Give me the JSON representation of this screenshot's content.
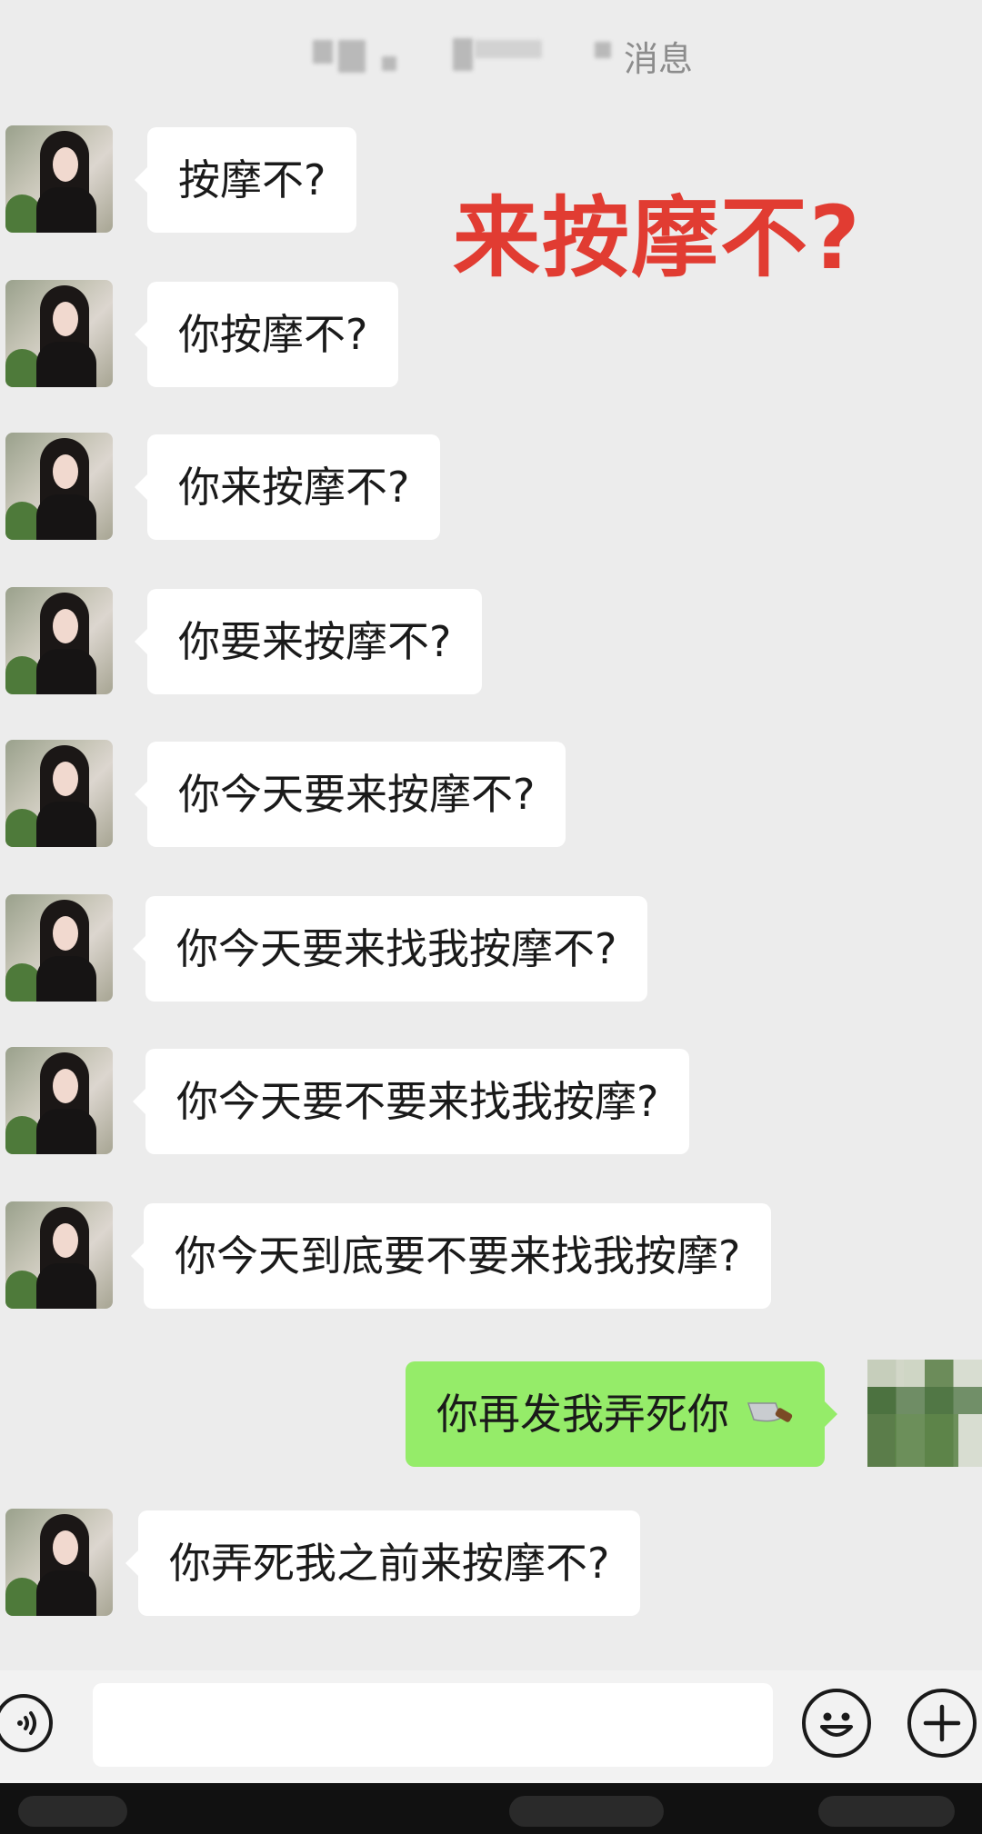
{
  "header": {
    "title": "消息"
  },
  "overlay_caption": "来按摩不?",
  "messages": [
    {
      "side": "left",
      "text": "按摩不?"
    },
    {
      "side": "left",
      "text": "你按摩不?"
    },
    {
      "side": "left",
      "text": "你来按摩不?"
    },
    {
      "side": "left",
      "text": "你要来按摩不?"
    },
    {
      "side": "left",
      "text": "你今天要来按摩不?"
    },
    {
      "side": "left",
      "text": "你今天要来找我按摩不?"
    },
    {
      "side": "left",
      "text": "你今天要不要来找我按摩?"
    },
    {
      "side": "left",
      "text": "你今天到底要不要来找我按摩?"
    },
    {
      "side": "right",
      "text": "你再发我弄死你",
      "emoji": "kitchen-knife-icon"
    },
    {
      "side": "left",
      "text": "你弄死我之前来按摩不?"
    }
  ],
  "input_bar": {
    "voice_icon": "voice-icon",
    "emoji_icon": "smiley-icon",
    "plus_icon": "plus-icon",
    "placeholder": ""
  },
  "colors": {
    "chat_background": "#ececec",
    "incoming_bubble": "#ffffff",
    "outgoing_bubble": "#95ec69",
    "caption_red": "#e13c32"
  }
}
